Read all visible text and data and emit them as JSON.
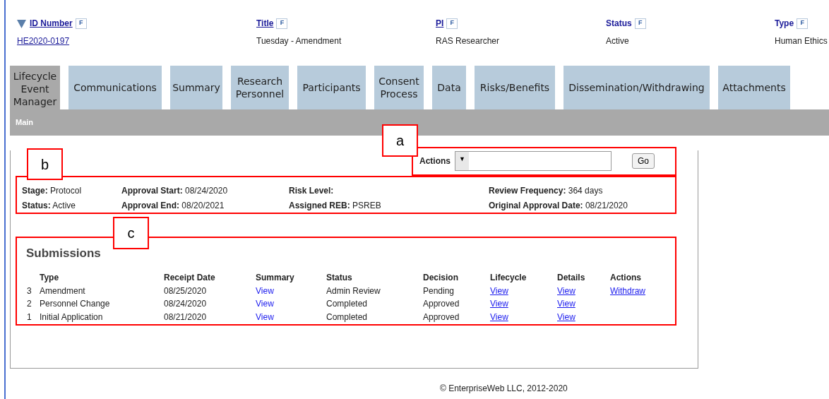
{
  "header_fields": [
    {
      "label": "ID Number",
      "value": "HE2020-0197",
      "label_link": true,
      "value_link": true,
      "sorted": true,
      "filter": "F"
    },
    {
      "label": "Title",
      "value": "Tuesday - Amendment",
      "label_link": true,
      "value_link": false,
      "sorted": false,
      "filter": "F"
    },
    {
      "label": "PI",
      "value": "RAS Researcher",
      "label_link": true,
      "value_link": false,
      "sorted": false,
      "filter": "F"
    },
    {
      "label": "Status",
      "value": "Active",
      "label_link": false,
      "value_link": false,
      "sorted": false,
      "filter": "F"
    },
    {
      "label": "Type",
      "value": "Human Ethics",
      "label_link": false,
      "value_link": false,
      "sorted": false,
      "filter": "F"
    }
  ],
  "tabs": [
    {
      "label": "Lifecycle Event Manager",
      "selected": true
    },
    {
      "label": "Communications",
      "selected": false
    },
    {
      "label": "Summary",
      "selected": false
    },
    {
      "label": "Research Personnel",
      "selected": false
    },
    {
      "label": "Participants",
      "selected": false
    },
    {
      "label": "Consent Process",
      "selected": false
    },
    {
      "label": "Data",
      "selected": false
    },
    {
      "label": "Risks/Benefits",
      "selected": false
    },
    {
      "label": "Dissemination/Withdrawing",
      "selected": false
    },
    {
      "label": "Attachments",
      "selected": false
    }
  ],
  "subtab": "Main",
  "actions": {
    "label": "Actions",
    "caret": "▼",
    "button": "Go"
  },
  "details": [
    [
      {
        "label": "Stage:",
        "value": "Protocol"
      },
      {
        "label": "Status:",
        "value": "Active"
      }
    ],
    [
      {
        "label": "Approval Start:",
        "value": "08/24/2020"
      },
      {
        "label": "Approval End:",
        "value": "08/20/2021"
      }
    ],
    [
      {
        "label": "Risk Level:"
      },
      {
        "label": "Assigned REB:",
        "value": "PSREB"
      }
    ],
    [
      {
        "label": "Review Frequency:",
        "value": "364 days"
      },
      {
        "label": "Original Approval Date:",
        "value": "08/21/2020"
      }
    ]
  ],
  "submissions": {
    "title": "Submissions",
    "columns": [
      "Type",
      "Receipt Date",
      "Summary",
      "Status",
      "Decision",
      "Lifecycle",
      "Details",
      "Actions"
    ],
    "rows": [
      {
        "number": "3",
        "type": "Amendment",
        "receipt_date": "08/25/2020",
        "summary": "View",
        "status": "Admin Review",
        "decision": "Pending",
        "lifecycle": "View",
        "details": "View",
        "actions": "Withdraw"
      },
      {
        "number": "2",
        "type": "Personnel Change",
        "receipt_date": "08/24/2020",
        "summary": "View",
        "status": "Completed",
        "decision": "Approved",
        "lifecycle": "View",
        "details": "View"
      },
      {
        "number": "1",
        "type": "Initial Application",
        "receipt_date": "08/21/2020",
        "summary": "View",
        "status": "Completed",
        "decision": "Approved",
        "lifecycle": "View",
        "details": "View"
      }
    ]
  },
  "annotations": [
    {
      "label": "a"
    },
    {
      "label": "b"
    },
    {
      "label": "c"
    }
  ],
  "footer": "© EnterpriseWeb LLC, 2012-2020"
}
